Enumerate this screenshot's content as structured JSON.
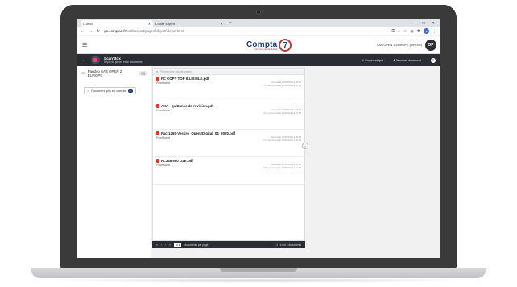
{
  "browser": {
    "tabs": [
      {
        "label": "i-Dépôt",
        "active": true
      },
      {
        "label": "i-Suite Expert",
        "active": false
      }
    ],
    "new_tab_icon": "plus-icon",
    "window_controls": [
      "–",
      "□",
      "✕"
    ],
    "url_host": "go.compta7.fr",
    "url_path": "/toolboxport/pages/idepot/idepot.html"
  },
  "header": {
    "logo_name": "Compta",
    "logo_number": "7",
    "logo_tagline": "Votre comptabilité digitale",
    "company": "SAS OPEN 2 EUROPE (OPEN2)",
    "user_initials": "OP"
  },
  "toolbar": {
    "title": "Scan'Box",
    "subtitle": "Dépôt de pièces et de documents",
    "multi_upload": "Envoi multiple",
    "new_document": "Nouveau document",
    "help": "?"
  },
  "left_panel": {
    "folder_label": "Pandoo SAS OPEN 2 EUROPE",
    "folder_count": "(5)",
    "selected_label": "Document pris en compte",
    "selected_count": "4"
  },
  "doc_list": {
    "search_placeholder": "Recherche rapide parmi",
    "documents": [
      {
        "name": "FC COPY TOP ILLISIBLE.pdf",
        "type": "Pièce Achat",
        "deposited": "Déposé le 30/08/2020 à 00:57",
        "taken": "Pris en compte le 30/08/2020 à 00:59"
      },
      {
        "name": "AXA - quittance de révision.pdf",
        "type": "Pièce Achat",
        "deposited": "Déposé le 30/08/2020 à 18:36",
        "taken": "Pris en compte le 30/08/2020 à 18:50"
      },
      {
        "name": "Fact1265-Vestiro_Open2Digital_04_2020.pdf",
        "type": "Pièce Achat",
        "deposited": "Déposé le 30/08/2020 à 08:43",
        "taken": "Pris en compte le 30/08/2020 à 09:07"
      },
      {
        "name": "FC346 980 O2E.pdf",
        "type": "Pièce Achat",
        "deposited": "Déposé le 27/08/2020 à 09:00",
        "taken": "Pris en compte le 27/08/2020 à 10:48"
      }
    ],
    "pager": {
      "nav": [
        "«",
        "‹",
        "›",
        "»"
      ],
      "per_page_value": "10",
      "per_page_label": "documents par page",
      "count_text": "1 - 4 sur 4 documents"
    }
  },
  "colors": {
    "brand_blue": "#1f3b8a",
    "brand_red": "#c0392b",
    "dark_bar": "#2a2d34",
    "pdf_red": "#e0322b"
  }
}
